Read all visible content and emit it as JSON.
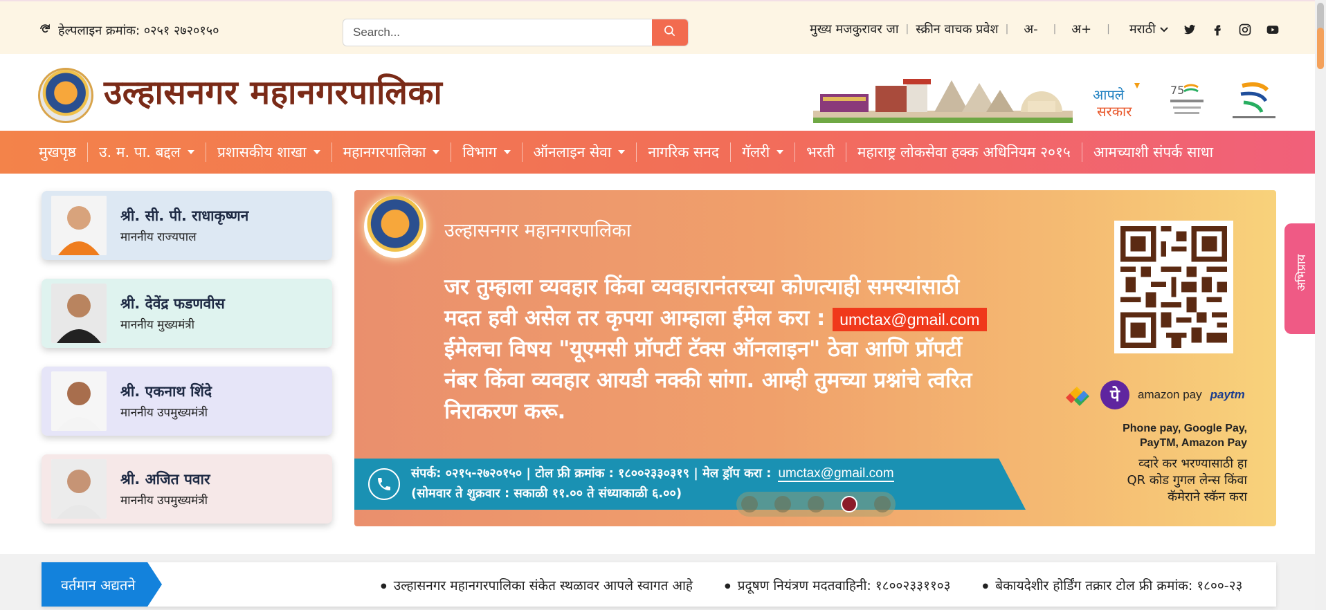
{
  "topbar": {
    "helpline": "हेल्पलाइन क्रमांक: ०२५१ २७२०१५०",
    "search_placeholder": "Search...",
    "links": [
      "मुख्य मजकुरावर जा",
      "स्क्रीन वाचक प्रवेश"
    ],
    "font_decrease": "अ-",
    "font_increase": "अ+",
    "language": "मराठी",
    "social": [
      "twitter-icon",
      "facebook-icon",
      "instagram-icon",
      "youtube-icon"
    ]
  },
  "header": {
    "title": "उल्हासनगर महानगरपालिका"
  },
  "nav": [
    {
      "label": "मुखपृष्ठ",
      "dropdown": false
    },
    {
      "label": "उ. म. पा. बद्दल",
      "dropdown": true
    },
    {
      "label": "प्रशासकीय शाखा",
      "dropdown": true
    },
    {
      "label": "महानगरपालिका",
      "dropdown": true
    },
    {
      "label": "विभाग",
      "dropdown": true
    },
    {
      "label": "ऑनलाइन सेवा",
      "dropdown": true
    },
    {
      "label": "नागरिक सनद",
      "dropdown": false
    },
    {
      "label": "गॅलरी",
      "dropdown": true
    },
    {
      "label": "भरती",
      "dropdown": false
    },
    {
      "label": "महाराष्ट्र लोकसेवा हक्क अधिनियम २०१५",
      "dropdown": false
    },
    {
      "label": "आमच्याशी संपर्क साधा",
      "dropdown": false
    }
  ],
  "leaders": [
    {
      "name": "श्री. सी. पी. राधाकृष्णन",
      "role": "माननीय राज्यपाल",
      "bg": "#dde8f3"
    },
    {
      "name": "श्री. देवेंद्र फडणवीस",
      "role": "माननीय मुख्यमंत्री",
      "bg": "#dff3ef"
    },
    {
      "name": "श्री. एकनाथ शिंदे",
      "role": "माननीय उपमुख्यमंत्री",
      "bg": "#e6e5f8"
    },
    {
      "name": "श्री. अजित पवार",
      "role": "माननीय उपमुख्यमंत्री",
      "bg": "#f6e8e8"
    }
  ],
  "banner": {
    "org": "उल्हासनगर महानगरपालिका",
    "line1": "जर तुम्हाला व्यवहार किंवा व्यवहारानंतरच्या कोणत्याही समस्यांसाठी",
    "line2": "मदत हवी असेल तर कृपया आम्हाला ईमेल करा :",
    "email": "umctax@gmail.com",
    "line3": "ईमेलचा विषय \"यूएमसी प्रॉपर्टी टॅक्स ऑनलाइन\" ठेवा आणि प्रॉपर्टी",
    "line4": "नंबर किंवा व्यवहार आयडी नक्की सांगा. आम्ही तुमच्या प्रश्नांचे त्वरित",
    "line5": "निराकरण करू.",
    "contact1": "संपर्क: ०२१५-२७२०१५० | टोल फ्री क्रमांक : १८००२३३०३१९ | मेल ड्रॉप करा :",
    "contact_email": "umctax@gmail.com",
    "contact2": "(सोमवार ते शुक्रवार : सकाळी ११.०० ते संध्याकाळी ६.००)",
    "amazon_pay": "amazon pay",
    "paytm": "paytm",
    "phonepe": "पे",
    "pay_names_1": "Phone pay, Google Pay,",
    "pay_names_2": "PayTM, Amazon Pay",
    "qr_note_1": "व्दारे कर भरण्यासाठी हा",
    "qr_note_2": "QR कोड गुगल लेन्स किंवा",
    "qr_note_3": "कॅमेराने स्कॅन करा",
    "slides": 5,
    "active_slide": 4
  },
  "feedback": "अभिप्राय",
  "ticker": {
    "label": "वर्तमान अद्यतने",
    "items": [
      "उल्हासनगर महानगरपालिका संकेत स्थळावर आपले स्वागत आहे",
      "प्रदूषण नियंत्रण मदतवाहिनी: १८००२३३११०३",
      "बेकायदेशीर होर्डिंग तक्रार टोल फ्री क्रमांक: १८००-२३"
    ]
  }
}
